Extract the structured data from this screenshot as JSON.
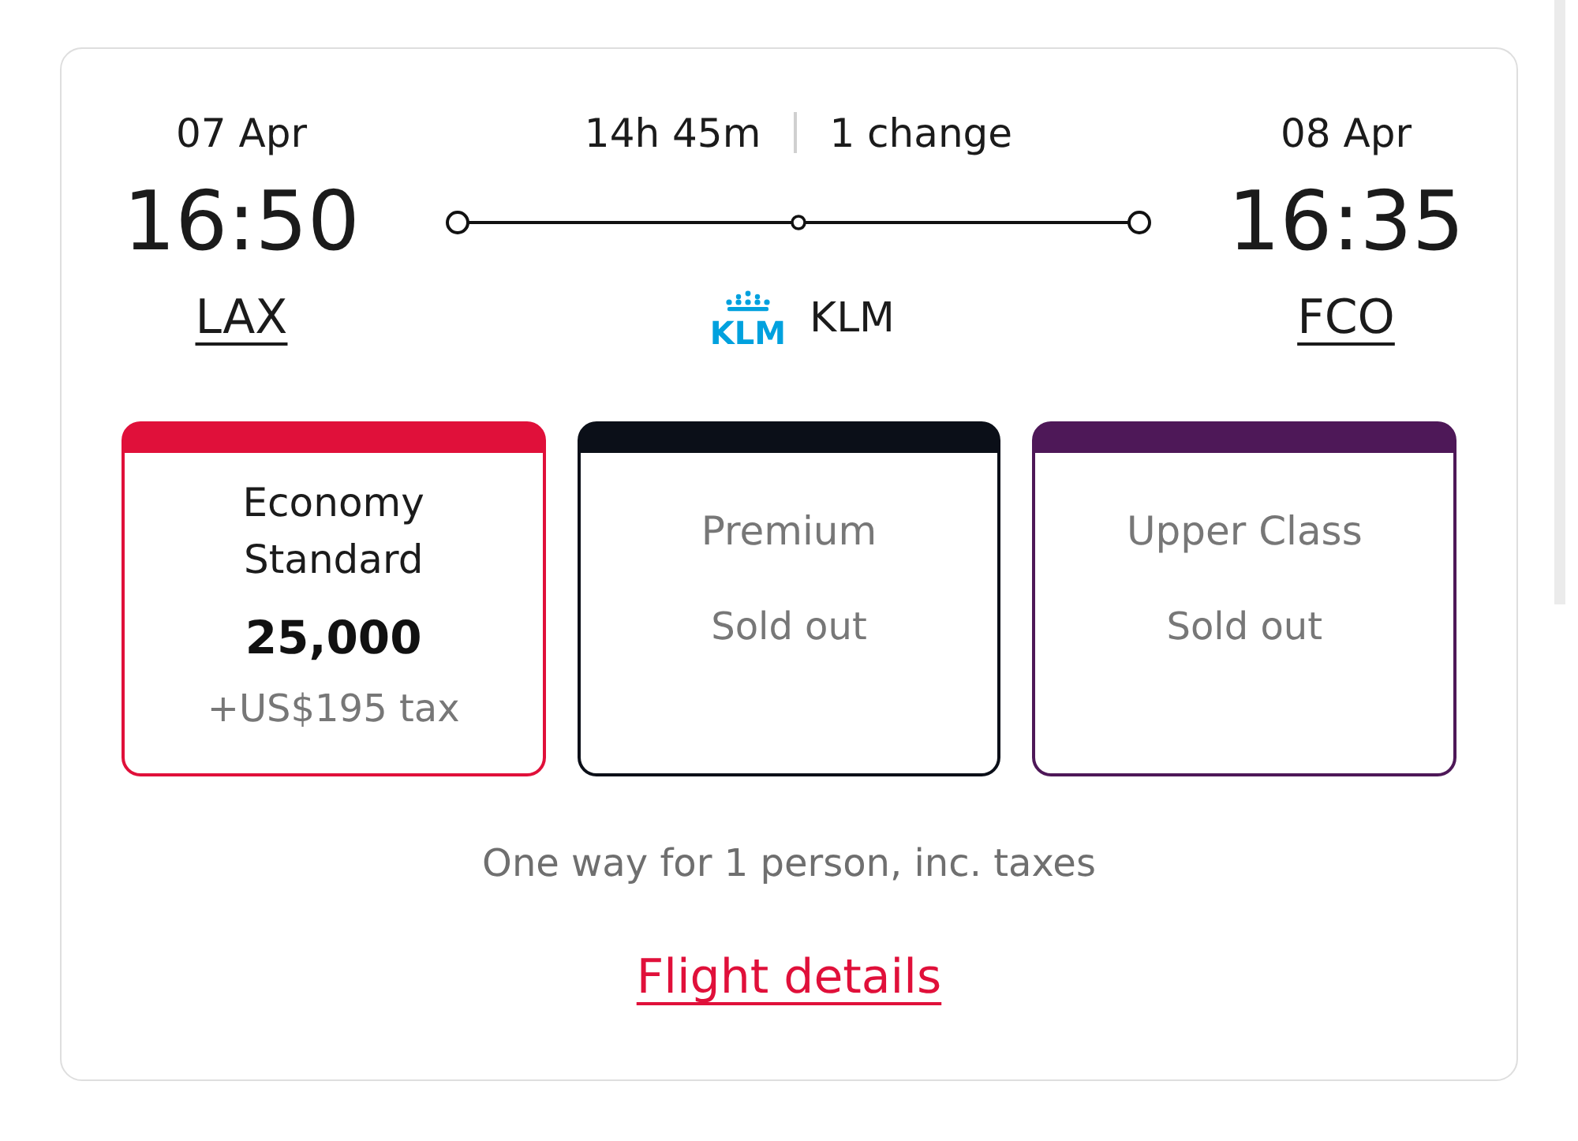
{
  "flight": {
    "departure": {
      "date": "07 Apr",
      "time": "16:50",
      "airport": "LAX"
    },
    "journey": {
      "duration": "14h 45m",
      "changes": "1 change"
    },
    "airline": {
      "logo_text": "KLM",
      "name": "KLM"
    },
    "arrival": {
      "date": "08 Apr",
      "time": "16:35",
      "airport": "FCO"
    }
  },
  "fares": [
    {
      "kind": "available",
      "cabin": "Economy Standard",
      "points": "25,000",
      "tax": "+US$195 tax",
      "color": "#e0103a"
    },
    {
      "kind": "sold_out",
      "cabin": "Premium",
      "status": "Sold out",
      "color": "#0b0f18"
    },
    {
      "kind": "sold_out",
      "cabin": "Upper Class",
      "status": "Sold out",
      "color": "#4e1858"
    }
  ],
  "note": "One way for 1 person, inc. taxes",
  "details_link": "Flight details"
}
